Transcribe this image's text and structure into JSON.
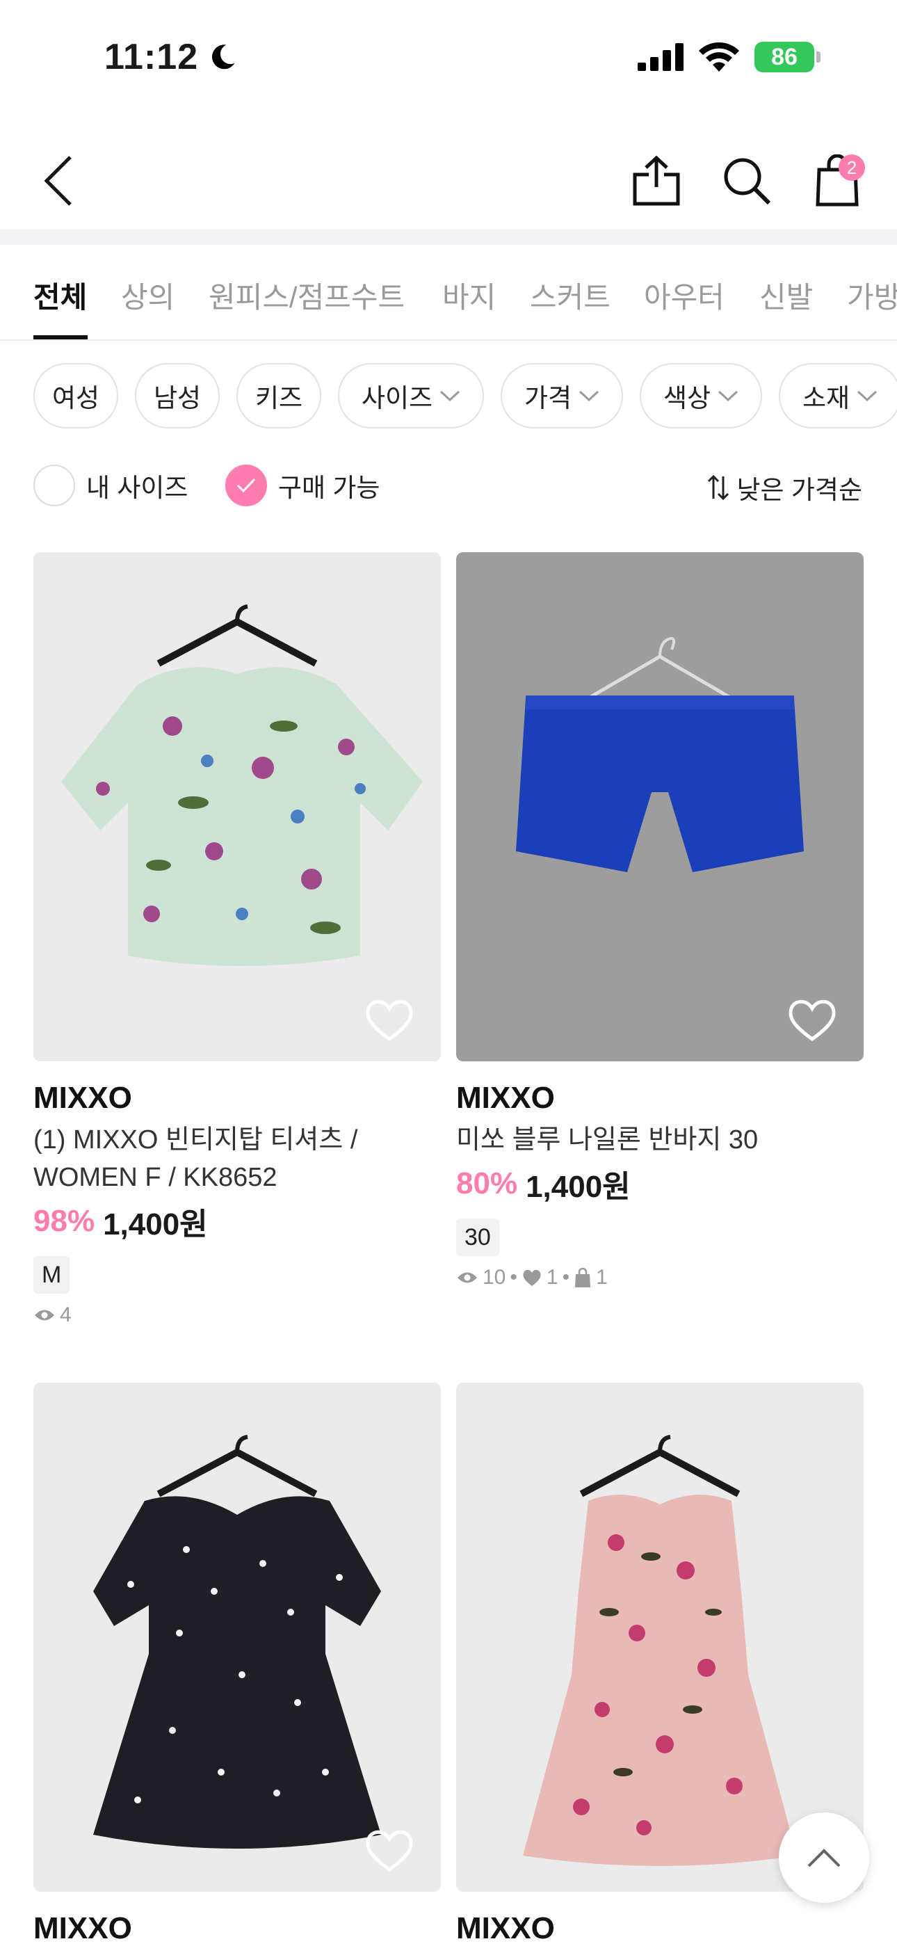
{
  "status_bar": {
    "time": "11:12",
    "battery": "86"
  },
  "nav": {
    "cart_count": "2"
  },
  "tabs": [
    "전체",
    "상의",
    "원피스/점프수트",
    "바지",
    "스커트",
    "아우터",
    "신발",
    "가방"
  ],
  "filters": {
    "chips": [
      "여성",
      "남성",
      "키즈",
      "사이즈",
      "가격",
      "색상",
      "소재"
    ],
    "my_size_label": "내 사이즈",
    "available_label": "구매 가능",
    "sort_label": "낮은 가격순"
  },
  "products": [
    {
      "brand": "MIXXO",
      "name": "(1) MIXXO 빈티지탑 티셔츠 / WOMEN F / KK8652",
      "discount": "98%",
      "price": "1,400원",
      "size": "M",
      "views": "4"
    },
    {
      "brand": "MIXXO",
      "name": "미쏘 블루 나일론 반바지 30",
      "discount": "80%",
      "price": "1,400원",
      "size": "30",
      "views": "10",
      "likes": "1",
      "sales": "1"
    },
    {
      "brand": "MIXXO"
    },
    {
      "brand": "MIXXO"
    }
  ],
  "colors": {
    "accent": "#ff7cae",
    "text": "#1a1a1a",
    "muted": "#9a9a9a"
  }
}
